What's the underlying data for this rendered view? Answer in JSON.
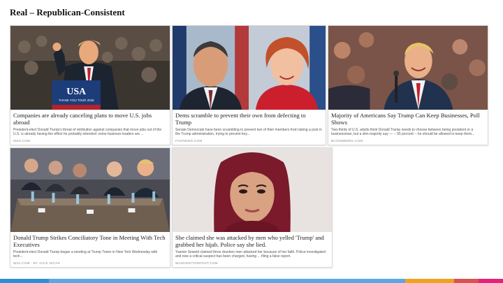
{
  "slide": {
    "title": "Real – Republican-Consistent"
  },
  "cards": [
    {
      "headline": "Companies are already canceling plans to move U.S. jobs abroad",
      "snippet": "President-elect Donald Trump's threat of retribution against companies that move jobs out of the U.S. is already having the effect he probably intended: some business leaders are ...",
      "source": "MSN.COM",
      "podium_text": "USA",
      "podium_subtext": "THANK YOU TOUR 2016"
    },
    {
      "headline": "Dems scramble to prevent their own from defecting to Trump",
      "snippet": "Senate Democrats have been scrambling to prevent two of their members from taking a post in the Trump administration, trying to prevent key...",
      "source": "FOXNEWS.COM"
    },
    {
      "headline": "Majority of Americans Say Trump Can Keep Businesses, Poll Shows",
      "snippet": "Two-thirds of U.S. adults think Donald Trump needs to choose between being president or a businessman, but a slim majority say — -- 55 percent -- he should be allowed to keep them...",
      "source": "BLOOMBERG.COM"
    },
    {
      "headline": "Donald Trump Strikes Conciliatory Tone in Meeting With Tech Executives",
      "snippet": "President-elect Donald Trump began a meeting at Trump Tower in New York Wednesday with tech...",
      "source": "WSJ.COM · BY JACK NICAS"
    },
    {
      "headline": "She claimed she was attacked by men who yelled 'Trump' and grabbed her hijab. Police say she lied.",
      "snippet": "Yasmin Seweid claimed three drunken men attacked her because of her faith. Police investigated and now a critical suspect has been charged, having ... filing a false report.",
      "source": "WASHINGTONPOST.COM"
    }
  ],
  "colors": {
    "footer": [
      "#2f8fd6",
      "#5aa8e0",
      "#f0a21e",
      "#d9534f",
      "#e2237a"
    ]
  }
}
